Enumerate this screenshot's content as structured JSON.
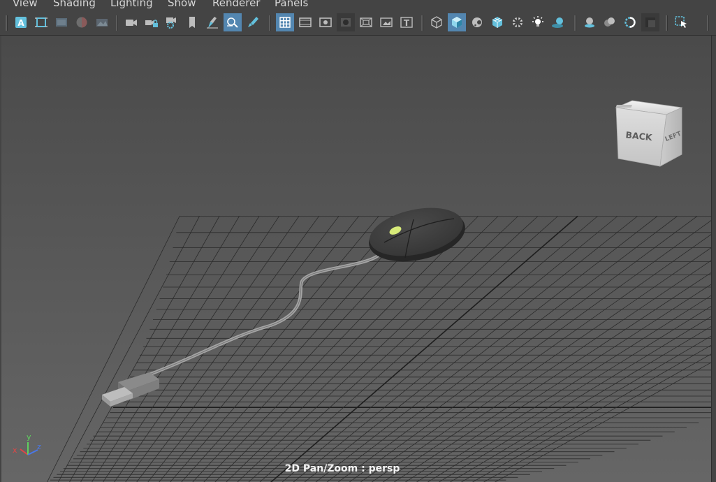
{
  "menubar": {
    "items": [
      {
        "name": "view",
        "label": "View"
      },
      {
        "name": "shading",
        "label": "Shading"
      },
      {
        "name": "lighting",
        "label": "Lighting"
      },
      {
        "name": "show",
        "label": "Show"
      },
      {
        "name": "renderer",
        "label": "Renderer"
      },
      {
        "name": "panels",
        "label": "Panels"
      }
    ]
  },
  "toolbar": {
    "groups": [
      [
        {
          "icon": "select-camera-icon",
          "glyph": "A",
          "state": "normal"
        },
        {
          "icon": "camera-attributes-icon",
          "state": "normal"
        },
        {
          "icon": "image-plane-icon",
          "state": "normal"
        },
        {
          "icon": "color-management-icon",
          "state": "normal"
        },
        {
          "icon": "depth-of-field-icon",
          "state": "normal"
        }
      ],
      [
        {
          "icon": "camera-icon",
          "state": "normal"
        },
        {
          "icon": "lock-camera-icon",
          "state": "normal"
        },
        {
          "icon": "camera-settings-icon",
          "state": "normal"
        },
        {
          "icon": "bookmark-icon",
          "state": "normal"
        },
        {
          "icon": "grease-pencil-icon",
          "state": "normal"
        },
        {
          "icon": "tumble-icon",
          "state": "active"
        },
        {
          "icon": "paint-brush-icon",
          "state": "normal"
        }
      ],
      [
        {
          "icon": "grid-icon",
          "state": "active"
        },
        {
          "icon": "film-gate-icon",
          "state": "normal"
        },
        {
          "icon": "resolution-gate-icon",
          "state": "normal"
        },
        {
          "icon": "gate-mask-icon",
          "state": "dim"
        },
        {
          "icon": "field-chart-icon",
          "state": "normal"
        },
        {
          "icon": "safe-action-icon",
          "state": "normal"
        },
        {
          "icon": "safe-title-icon",
          "glyph": "T",
          "state": "normal"
        }
      ],
      [
        {
          "icon": "wireframe-icon",
          "state": "normal"
        },
        {
          "icon": "smooth-shade-icon",
          "state": "active"
        },
        {
          "icon": "default-material-icon",
          "state": "normal"
        },
        {
          "icon": "wireframe-on-shaded-icon",
          "state": "normal"
        },
        {
          "icon": "textured-icon",
          "state": "normal"
        },
        {
          "icon": "use-all-lights-icon",
          "state": "normal"
        },
        {
          "icon": "shadows-icon",
          "state": "normal"
        }
      ],
      [
        {
          "icon": "screen-space-ao-icon",
          "state": "normal"
        },
        {
          "icon": "motion-blur-icon",
          "state": "normal"
        },
        {
          "icon": "anti-aliasing-icon",
          "state": "normal"
        },
        {
          "icon": "depth-peeling-icon",
          "state": "dim"
        }
      ],
      [
        {
          "icon": "isolate-select-icon",
          "state": "normal"
        }
      ]
    ]
  },
  "viewcube": {
    "back_label": "BACK",
    "left_label": "LEFT"
  },
  "axis_gizmo": {
    "x": "x",
    "y": "y",
    "z": "z"
  },
  "hud": {
    "camera_label": "2D Pan/Zoom : persp"
  },
  "colors": {
    "viewport_bg_top": "#4a4a4a",
    "viewport_bg_bottom": "#666666",
    "grid": "#2b2b2b",
    "grid_axis": "#1e1e1e",
    "active_button": "#5386b0",
    "icon_blue": "#63c0dc",
    "mouse_body": "#353535",
    "scroll_wheel": "#d8eb79",
    "cable": "#a4a4a4",
    "usb_plug": "#8a8a8a"
  }
}
